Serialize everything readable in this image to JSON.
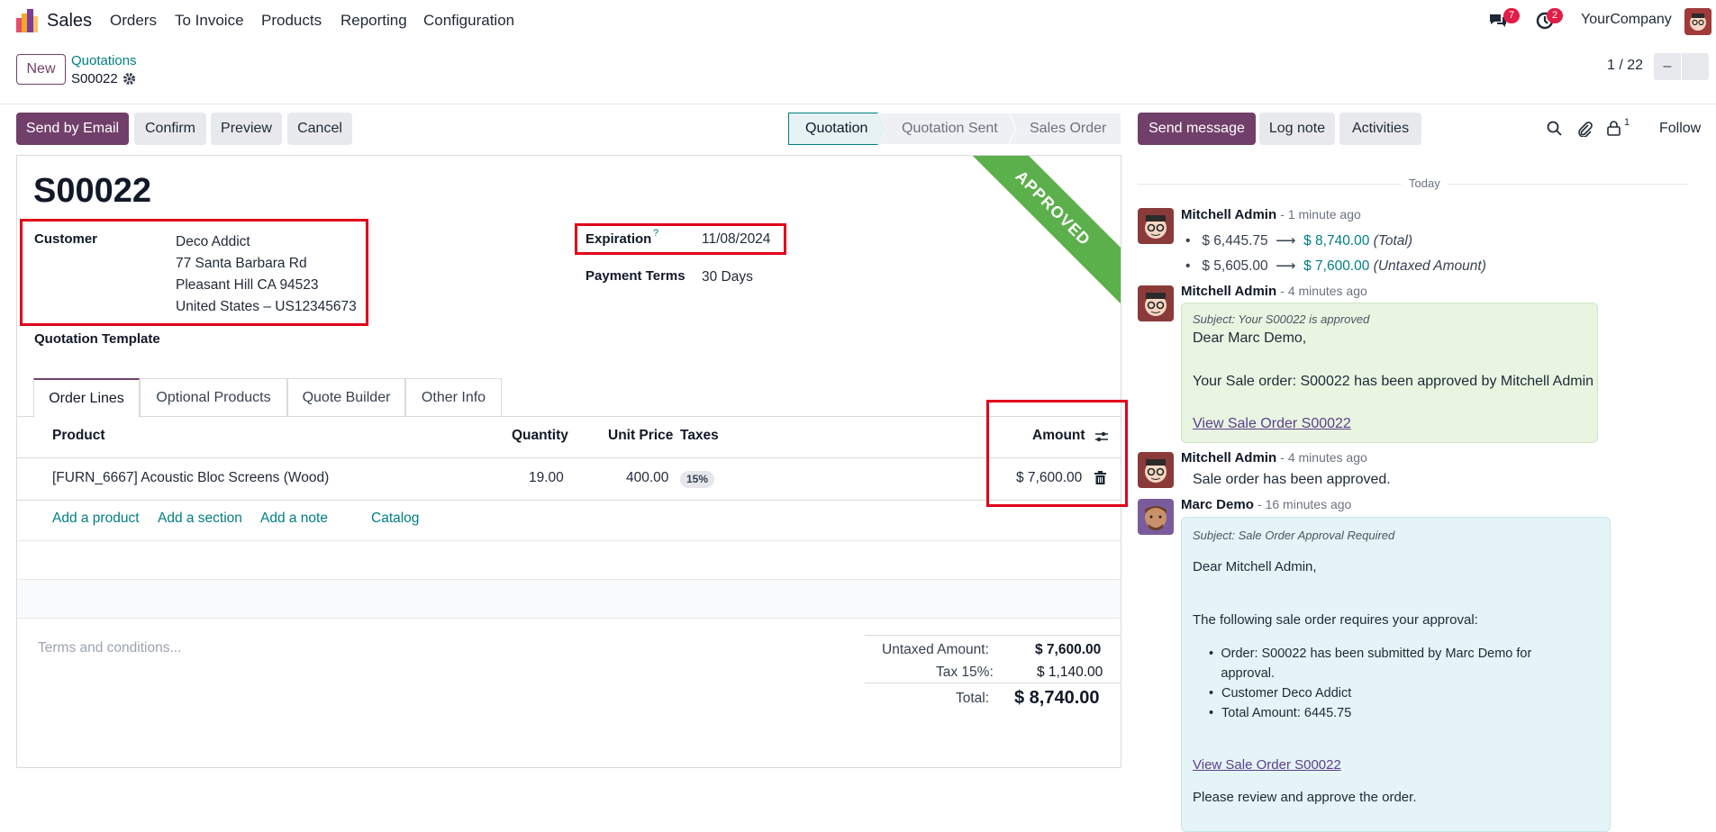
{
  "nav": {
    "app_name": "Sales",
    "menu": [
      "Orders",
      "To Invoice",
      "Products",
      "Reporting",
      "Configuration"
    ],
    "messages_badge": "7",
    "activities_badge": "2",
    "company": "YourCompany"
  },
  "control_panel": {
    "new_label": "New",
    "breadcrumb_parent": "Quotations",
    "record_name": "S00022",
    "pager": "1 / 22",
    "pager_prev": "–"
  },
  "status_bar": {
    "buttons": [
      "Send by Email",
      "Confirm",
      "Preview",
      "Cancel"
    ],
    "stages": [
      "Quotation",
      "Quotation Sent",
      "Sales Order"
    ],
    "active_stage": "Quotation"
  },
  "form": {
    "title": "S00022",
    "ribbon": "APPROVED",
    "customer_label": "Customer",
    "customer_lines": [
      "Deco Addict",
      "77 Santa Barbara Rd",
      "Pleasant Hill CA 94523",
      "United States – US12345673"
    ],
    "expiration_label": "Expiration",
    "expiration_help": "?",
    "expiration_value": "11/08/2024",
    "payment_terms_label": "Payment Terms",
    "payment_terms_value": "30 Days",
    "template_label": "Quotation Template",
    "tabs": [
      "Order Lines",
      "Optional Products",
      "Quote Builder",
      "Other Info"
    ],
    "active_tab": "Order Lines",
    "columns": {
      "product": "Product",
      "quantity": "Quantity",
      "unit_price": "Unit Price",
      "taxes": "Taxes",
      "amount": "Amount"
    },
    "lines": [
      {
        "product": "[FURN_6667] Acoustic Bloc Screens (Wood)",
        "quantity": "19.00",
        "unit_price": "400.00",
        "tax": "15%",
        "amount": "$ 7,600.00"
      }
    ],
    "add_links": [
      "Add a product",
      "Add a section",
      "Add a note",
      "Catalog"
    ],
    "terms_placeholder": "Terms and conditions...",
    "totals": {
      "untaxed_label": "Untaxed Amount:",
      "untaxed_value": "$ 7,600.00",
      "tax_label": "Tax 15%:",
      "tax_value": "$ 1,140.00",
      "total_label": "Total:",
      "total_value": "$ 8,740.00"
    }
  },
  "chatter": {
    "buttons": {
      "send": "Send message",
      "log": "Log note",
      "activities": "Activities",
      "follow": "Follow"
    },
    "follower_count": "1",
    "date_separator": "Today",
    "messages": [
      {
        "author": "Mitchell Admin",
        "time": "- 1 minute ago",
        "changes": [
          {
            "old": "$ 6,445.75",
            "new": "$ 8,740.00",
            "field": "(Total)"
          },
          {
            "old": "$ 5,605.00",
            "new": "$ 7,600.00",
            "field": "(Untaxed Amount)"
          }
        ]
      },
      {
        "author": "Mitchell Admin",
        "time": "- 4 minutes ago",
        "subject": "Subject: Your S00022 is approved",
        "greeting": "Dear Marc Demo,",
        "body": "Your Sale order: S00022 has been approved by Mitchell Admin",
        "link": "View Sale Order S00022"
      },
      {
        "author": "Mitchell Admin",
        "time": "- 4 minutes ago",
        "body": "Sale order has been approved."
      },
      {
        "author": "Marc Demo",
        "time": "- 16 minutes ago",
        "subject": "Subject: Sale Order Approval Required",
        "greeting": "Dear Mitchell Admin,",
        "intro": "The following sale order requires your approval:",
        "bullets": [
          "Order: S00022 has been submitted by Marc Demo for approval.",
          "Customer Deco Addict",
          "Total Amount: 6445.75"
        ],
        "link": "View Sale Order S00022",
        "closing": "Please review and approve the order."
      }
    ]
  },
  "colors": {
    "brand": "#71406a",
    "accent": "#017e84",
    "ribbon": "#5bb04b",
    "highlight": "#e0001b"
  }
}
